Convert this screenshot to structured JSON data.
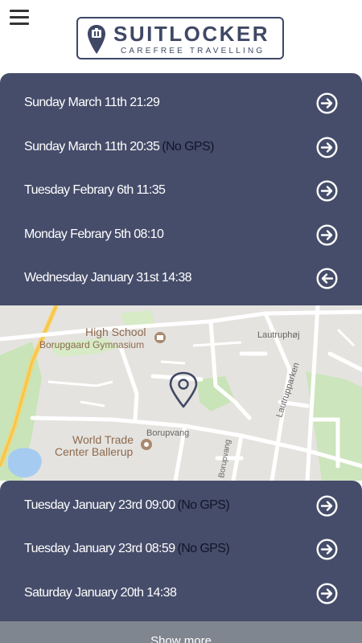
{
  "header": {
    "logo_title": "SUITLOCKER",
    "logo_subtitle": "CAREFREE TRAVELLING"
  },
  "history_top": [
    {
      "label": "Sunday March 11th 21:29",
      "note": "",
      "icon": "arrow-right-circle-icon"
    },
    {
      "label": "Sunday March 11th 20:35",
      "note": "(No GPS)",
      "icon": "arrow-right-circle-icon"
    },
    {
      "label": "Tuesday Febrary 6th 11:35",
      "note": "",
      "icon": "arrow-right-circle-icon"
    },
    {
      "label": "Monday Febrary 5th 08:10",
      "note": "",
      "icon": "arrow-right-circle-icon"
    },
    {
      "label": "Wednesday January 31st 14:38",
      "note": "",
      "icon": "arrow-left-circle-icon"
    }
  ],
  "map": {
    "labels": {
      "school_line1": "High School",
      "school_line2": "Borupgaard Gymnasium",
      "wtc_line1": "World Trade",
      "wtc_line2": "Center Ballerup",
      "street_borupvang": "Borupvang",
      "street_lautruphoj": "Lautruphøj",
      "street_lautrupparken": "Lautrupparken",
      "street_borupvang_vertical": "Borupvang"
    },
    "marker_icon": "location-pin-icon"
  },
  "history_bottom": [
    {
      "label": "Tuesday January 23rd 09:00",
      "note": "(No GPS)",
      "icon": "arrow-right-circle-icon"
    },
    {
      "label": "Tuesday January 23rd 08:59",
      "note": "(No GPS)",
      "icon": "arrow-right-circle-icon"
    },
    {
      "label": "Saturday January 20th 14:38",
      "note": "",
      "icon": "arrow-right-circle-icon"
    }
  ],
  "show_more_label": "Show more",
  "colors": {
    "panel": "#464d6a",
    "brand": "#3f4865",
    "no_gps": "#12152a",
    "show_more_bar": "#80868f"
  }
}
